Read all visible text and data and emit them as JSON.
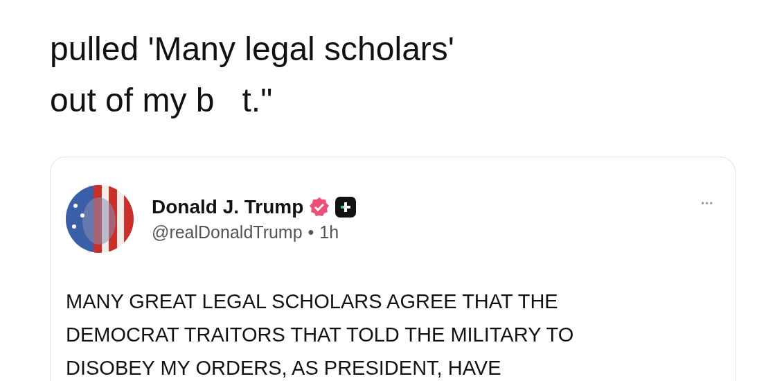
{
  "caption": {
    "lines": [
      "pulled 'Many legal scholars'",
      "out of my b   t.\""
    ]
  },
  "quoted_post": {
    "author": {
      "name": "Donald J. Trump",
      "verified": true,
      "handle": "@realDonaldTrump",
      "separator": "•",
      "time": "1h"
    },
    "more": "•••",
    "body_lines": [
      "MANY GREAT LEGAL SCHOLARS AGREE THAT THE",
      "DEMOCRAT TRAITORS THAT TOLD THE MILITARY TO",
      "DISOBEY MY ORDERS, AS PRESIDENT, HAVE"
    ]
  }
}
